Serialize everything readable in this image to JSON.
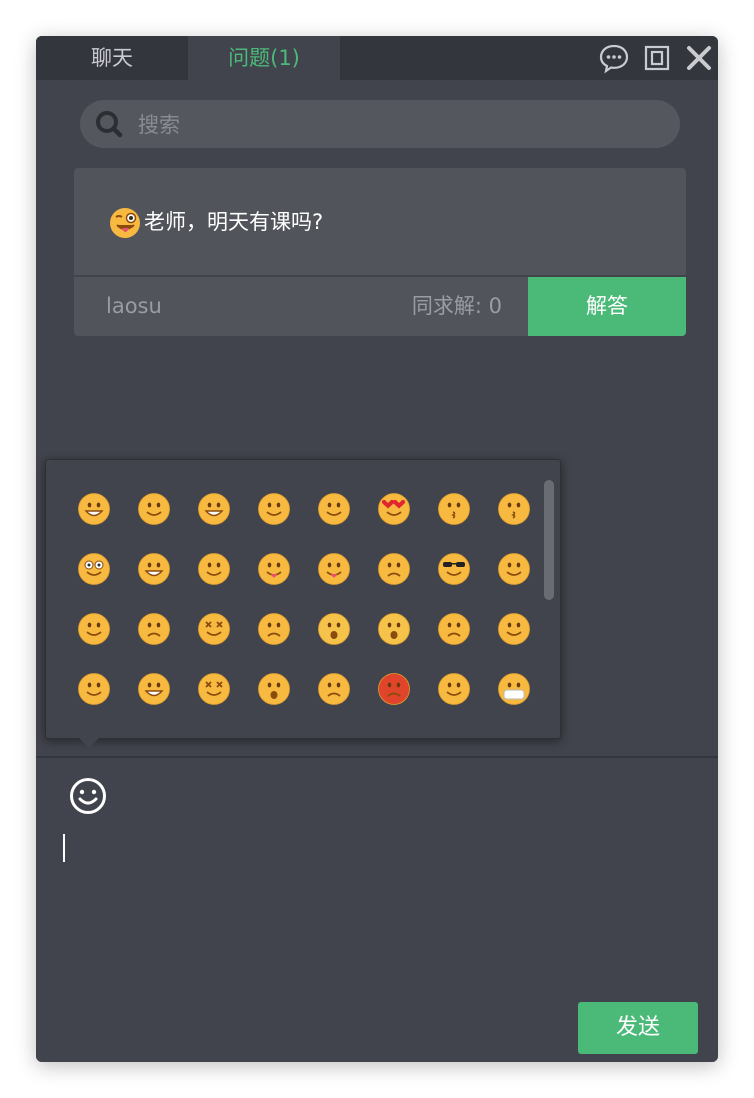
{
  "colors": {
    "accent": "#4bba79",
    "window_bg": "#42444d",
    "tabbar_bg": "#34363d",
    "card_bg": "#52545c",
    "muted_text": "#9a9ca3"
  },
  "tabs": [
    {
      "label": "聊天",
      "active": false
    },
    {
      "label": "问题(1)",
      "active": true
    }
  ],
  "window_controls": [
    "chat-bubble-icon",
    "restore-icon",
    "close-icon"
  ],
  "search": {
    "placeholder": "搜索",
    "value": ""
  },
  "question": {
    "emoji": "winking-tongue-emoji",
    "text": "老师，明天有课吗?",
    "user": "laosu",
    "same_request": "同求解: 0",
    "answer_label": "解答"
  },
  "emoji_picker": {
    "emojis": [
      "grinning",
      "smiling",
      "big-smile",
      "blushing-smile",
      "wink",
      "heart-eyes",
      "kissing-heart",
      "kissing",
      "flushed",
      "grimacing",
      "zipper-mouth",
      "winking-tongue",
      "squinting-tongue",
      "unamused",
      "sunglasses",
      "cold-sweat",
      "thinking",
      "pensive",
      "confounded",
      "disappointed-relieved",
      "fearful",
      "anxious",
      "persevering",
      "crying",
      "loudly-crying",
      "tears-of-joy",
      "dizzy",
      "screaming",
      "angry",
      "pouting",
      "sleepy",
      "medical-mask"
    ]
  },
  "composer": {
    "placeholder": "",
    "value": ""
  },
  "send_label": "发送"
}
